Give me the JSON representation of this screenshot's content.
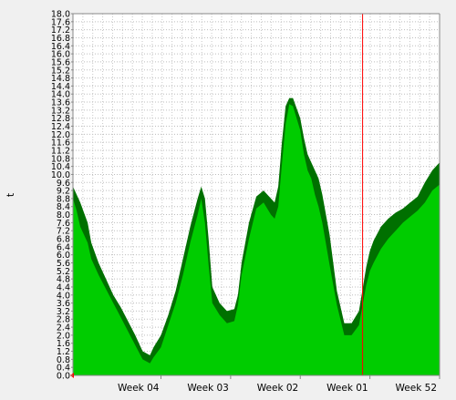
{
  "chart_data": {
    "type": "area",
    "ylabel": "t",
    "ylim": [
      0,
      18
    ],
    "y_tick_step": 0.4,
    "y_tick_labels": [
      "0.0",
      "0.4",
      "0.8",
      "1.2",
      "1.6",
      "2.0",
      "2.4",
      "2.8",
      "3.2",
      "3.6",
      "4.0",
      "4.4",
      "4.8",
      "5.2",
      "5.6",
      "6.0",
      "6.4",
      "6.8",
      "7.2",
      "7.6",
      "8.0",
      "8.4",
      "8.8",
      "9.2",
      "9.6",
      "10.0",
      "10.4",
      "10.8",
      "11.2",
      "11.6",
      "12.0",
      "12.4",
      "12.8",
      "13.2",
      "13.6",
      "14.0",
      "14.4",
      "14.8",
      "15.2",
      "15.6",
      "16.0",
      "16.4",
      "16.8",
      "17.2",
      "17.6",
      "18.0"
    ],
    "x_tick_labels": [
      "Week 04",
      "Week 03",
      "Week 02",
      "Week 01",
      "Week 52"
    ],
    "x_major_ticks": [
      0.24,
      0.43,
      0.62,
      0.81,
      1.0
    ],
    "x_minor_tick_count": 37,
    "marker_line_x": 0.79,
    "grid": true,
    "series": [
      {
        "color": "#00cc00",
        "x": [
          0,
          0.01,
          0.02,
          0.04,
          0.05,
          0.07,
          0.09,
          0.11,
          0.13,
          0.15,
          0.17,
          0.19,
          0.21,
          0.22,
          0.24,
          0.26,
          0.28,
          0.3,
          0.32,
          0.34,
          0.35,
          0.36,
          0.37,
          0.38,
          0.4,
          0.42,
          0.44,
          0.45,
          0.46,
          0.48,
          0.5,
          0.52,
          0.54,
          0.55,
          0.56,
          0.57,
          0.58,
          0.59,
          0.6,
          0.61,
          0.62,
          0.63,
          0.64,
          0.65,
          0.66,
          0.67,
          0.68,
          0.7,
          0.72,
          0.74,
          0.76,
          0.78,
          0.79,
          0.8,
          0.81,
          0.82,
          0.84,
          0.86,
          0.88,
          0.9,
          0.92,
          0.94,
          0.96,
          0.98,
          1.0
        ],
        "values": [
          8.8,
          8.2,
          7.4,
          6.6,
          5.8,
          5.0,
          4.3,
          3.6,
          2.9,
          2.2,
          1.5,
          0.8,
          0.6,
          0.9,
          1.4,
          2.5,
          3.6,
          5.0,
          6.6,
          8.0,
          8.8,
          7.6,
          5.5,
          3.6,
          3.0,
          2.6,
          2.7,
          3.5,
          5.0,
          6.8,
          8.3,
          8.6,
          8.0,
          7.8,
          8.4,
          10.5,
          12.5,
          13.5,
          13.4,
          12.8,
          12.2,
          11.0,
          10.2,
          9.8,
          9.0,
          8.4,
          7.6,
          5.5,
          3.5,
          2.0,
          2.0,
          2.5,
          3.5,
          4.5,
          5.2,
          5.6,
          6.3,
          6.8,
          7.2,
          7.6,
          7.9,
          8.2,
          8.6,
          9.2,
          9.5
        ]
      },
      {
        "color": "#007000",
        "x": [
          0,
          0.01,
          0.02,
          0.04,
          0.05,
          0.07,
          0.09,
          0.11,
          0.13,
          0.15,
          0.17,
          0.19,
          0.21,
          0.22,
          0.24,
          0.26,
          0.28,
          0.3,
          0.32,
          0.34,
          0.35,
          0.36,
          0.37,
          0.38,
          0.4,
          0.42,
          0.44,
          0.45,
          0.46,
          0.48,
          0.5,
          0.52,
          0.54,
          0.55,
          0.56,
          0.57,
          0.58,
          0.59,
          0.6,
          0.61,
          0.62,
          0.63,
          0.64,
          0.65,
          0.66,
          0.67,
          0.68,
          0.7,
          0.72,
          0.74,
          0.76,
          0.78,
          0.79,
          0.8,
          0.81,
          0.82,
          0.84,
          0.86,
          0.88,
          0.9,
          0.92,
          0.94,
          0.96,
          0.98,
          1.0
        ],
        "values": [
          9.4,
          9.0,
          8.6,
          7.6,
          6.6,
          5.6,
          4.8,
          4.0,
          3.4,
          2.7,
          2.0,
          1.2,
          1.0,
          1.4,
          2.0,
          3.0,
          4.2,
          5.8,
          7.4,
          8.8,
          9.4,
          8.8,
          6.8,
          4.4,
          3.6,
          3.2,
          3.3,
          4.0,
          5.6,
          7.6,
          8.9,
          9.2,
          8.8,
          8.6,
          9.4,
          11.6,
          13.4,
          13.8,
          13.8,
          13.3,
          12.8,
          11.8,
          11.0,
          10.6,
          10.2,
          9.8,
          9.0,
          7.0,
          4.2,
          2.6,
          2.6,
          3.2,
          4.3,
          5.4,
          6.2,
          6.7,
          7.4,
          7.8,
          8.1,
          8.3,
          8.6,
          8.9,
          9.6,
          10.2,
          10.6
        ]
      }
    ]
  }
}
